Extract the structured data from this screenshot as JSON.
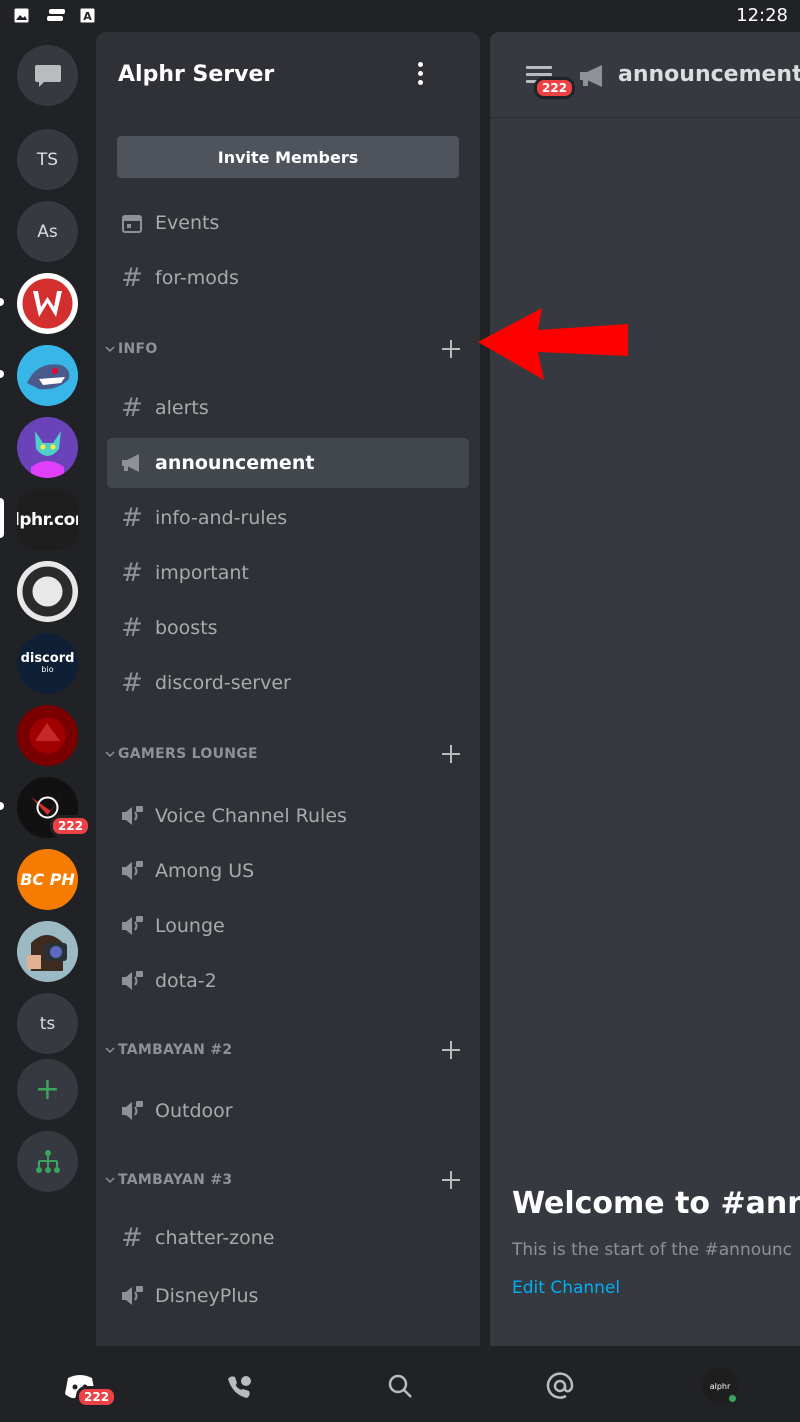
{
  "status_bar": {
    "time": "12:28"
  },
  "rail": {
    "dm_icon": "chat-bubble-icon",
    "servers": [
      {
        "initials": "TS"
      },
      {
        "initials": "As"
      },
      {
        "initials": ""
      },
      {
        "initials": ""
      },
      {
        "initials": ""
      },
      {
        "initials": "alphr.com"
      },
      {
        "initials": ""
      },
      {
        "initials": "discord",
        "sub": "bio"
      },
      {
        "initials": ""
      },
      {
        "initials": "",
        "badge": "222"
      },
      {
        "initials": "BC PH"
      },
      {
        "initials": ""
      },
      {
        "initials": "ts"
      }
    ],
    "add_server": "+",
    "explore_icon": "explore-hub-icon"
  },
  "panel": {
    "server_name": "Alphr Server",
    "invite_label": "Invite Members",
    "top_items": [
      {
        "icon": "calendar-icon",
        "label": "Events"
      },
      {
        "icon": "hash-icon",
        "label": "for-mods"
      }
    ],
    "categories": [
      {
        "title": "INFO",
        "channels": [
          {
            "icon": "hash-icon",
            "label": "alerts"
          },
          {
            "icon": "megaphone-icon",
            "label": "announcement",
            "selected": true
          },
          {
            "icon": "hash-icon",
            "label": "info-and-rules"
          },
          {
            "icon": "hash-icon",
            "label": "important"
          },
          {
            "icon": "hash-icon",
            "label": "boosts"
          },
          {
            "icon": "hash-icon",
            "label": "discord-server"
          }
        ]
      },
      {
        "title": "GAMERS LOUNGE",
        "channels": [
          {
            "icon": "locked-speaker-icon",
            "label": "Voice Channel Rules"
          },
          {
            "icon": "locked-speaker-icon",
            "label": "Among US"
          },
          {
            "icon": "locked-speaker-icon",
            "label": "Lounge"
          },
          {
            "icon": "locked-speaker-icon",
            "label": "dota-2"
          }
        ]
      },
      {
        "title": "TAMBAYAN #2",
        "channels": [
          {
            "icon": "locked-speaker-icon",
            "label": "Outdoor"
          }
        ]
      },
      {
        "title": "TAMBAYAN #3",
        "channels": [
          {
            "icon": "hash-icon",
            "label": "chatter-zone"
          },
          {
            "icon": "locked-speaker-icon",
            "label": "DisneyPlus"
          }
        ]
      }
    ]
  },
  "main": {
    "channel_name": "announcement",
    "unread_badge": "222",
    "welcome_title": "Welcome to #anno",
    "welcome_sub": "This is the start of the #announc",
    "edit_link": "Edit Channel"
  },
  "bottom_nav": {
    "home_badge": "222",
    "profile_text": "alphr"
  },
  "colors": {
    "accent_link": "#00aff4",
    "badge_red": "#ed4245",
    "arrow_red": "#ff0000",
    "online_green": "#3ba55d"
  }
}
